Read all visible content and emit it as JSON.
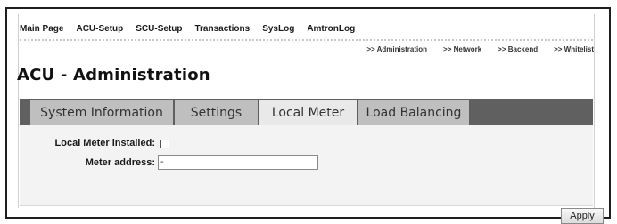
{
  "topnav": {
    "items": [
      "Main Page",
      "ACU-Setup",
      "SCU-Setup",
      "Transactions",
      "SysLog",
      "AmtronLog"
    ]
  },
  "subnav": {
    "items": [
      ">> Administration",
      ">> Network",
      ">> Backend",
      ">> Whitelist"
    ]
  },
  "page": {
    "title": "ACU - Administration"
  },
  "tabs": [
    {
      "label": "System Information",
      "active": false
    },
    {
      "label": "Settings",
      "active": false
    },
    {
      "label": "Local Meter",
      "active": true
    },
    {
      "label": "Load Balancing",
      "active": false
    }
  ],
  "form": {
    "meter_installed_label": "Local Meter installed:",
    "meter_installed_checked": false,
    "meter_address_label": "Meter address:",
    "meter_address_value": "-"
  },
  "actions": {
    "apply_label": "Apply"
  }
}
